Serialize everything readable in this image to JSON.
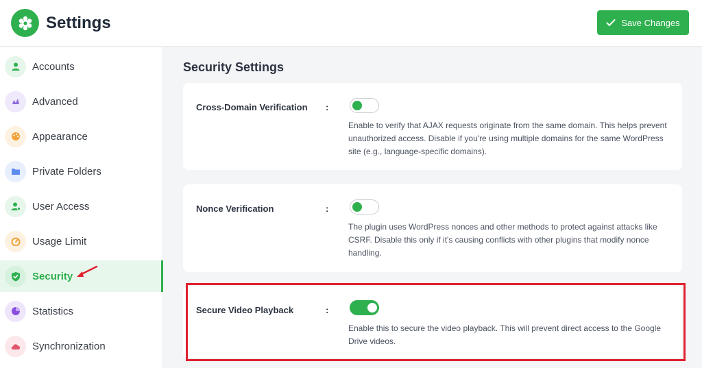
{
  "header": {
    "title": "Settings",
    "save_label": "Save Changes"
  },
  "sidebar": {
    "items": [
      {
        "label": "Accounts",
        "icon": "user-icon",
        "color": "#2eb04e",
        "bg": "#e6f6ea"
      },
      {
        "label": "Advanced",
        "icon": "tuning-icon",
        "color": "#8a6bd8",
        "bg": "#efe9fb"
      },
      {
        "label": "Appearance",
        "icon": "palette-icon",
        "color": "#f0a43a",
        "bg": "#fdf1e1"
      },
      {
        "label": "Private Folders",
        "icon": "folder-icon",
        "color": "#5b8def",
        "bg": "#e7eefc"
      },
      {
        "label": "User Access",
        "icon": "user-access-icon",
        "color": "#2eb04e",
        "bg": "#e6f6ea"
      },
      {
        "label": "Usage Limit",
        "icon": "limit-icon",
        "color": "#f0a43a",
        "bg": "#fdf1e1"
      },
      {
        "label": "Security",
        "icon": "shield-icon",
        "color": "#2eb04e",
        "bg": "#d6f1dd",
        "active": true
      },
      {
        "label": "Statistics",
        "icon": "pie-chart-icon",
        "color": "#8a4fe0",
        "bg": "#efe6fb"
      },
      {
        "label": "Synchronization",
        "icon": "cloud-sync-icon",
        "color": "#e0566b",
        "bg": "#fce8eb"
      }
    ]
  },
  "main": {
    "section_title": "Security Settings",
    "options": [
      {
        "label": "Cross-Domain Verification",
        "colon": ":",
        "enabled": false,
        "description": "Enable to verify that AJAX requests originate from the same domain. This helps prevent unauthorized access. Disable if you're using multiple domains for the same WordPress site (e.g., language-specific domains)."
      },
      {
        "label": "Nonce Verification",
        "colon": ":",
        "enabled": false,
        "description": "The plugin uses WordPress nonces and other methods to protect against attacks like CSRF. Disable this only if it's causing conflicts with other plugins that modify nonce handling."
      },
      {
        "label": "Secure Video Playback",
        "colon": ":",
        "enabled": true,
        "description": "Enable this to secure the video playback. This will prevent direct access to the Google Drive videos."
      }
    ]
  },
  "colors": {
    "accent": "#2eb04e",
    "highlight": "#e0202e"
  }
}
